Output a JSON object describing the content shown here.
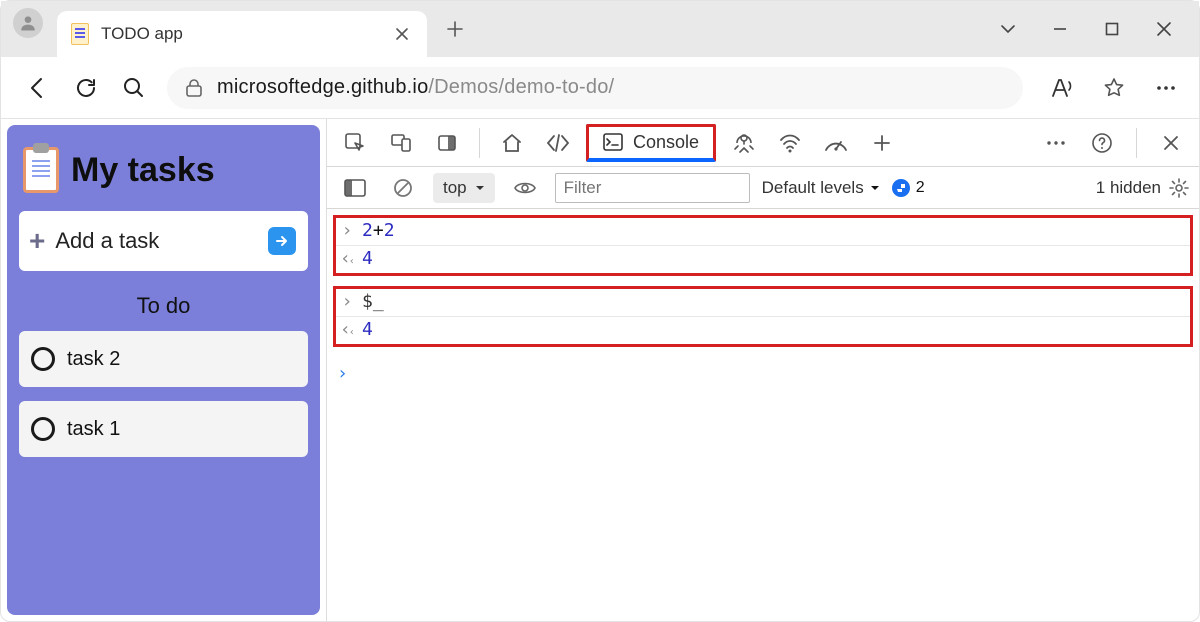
{
  "window": {
    "tab_title": "TODO app"
  },
  "urlbar": {
    "host": "microsoftedge.github.io",
    "path": "/Demos/demo-to-do/"
  },
  "page": {
    "heading": "My tasks",
    "add_placeholder": "Add a task",
    "section": "To do",
    "tasks": [
      {
        "label": "task 2"
      },
      {
        "label": "task 1"
      }
    ]
  },
  "devtools": {
    "tabs": {
      "console": "Console"
    },
    "toolbar": {
      "context": "top",
      "filter_placeholder": "Filter",
      "levels": "Default levels",
      "issues_count": "2",
      "hidden": "1 hidden"
    },
    "log": [
      {
        "type": "group",
        "rows": [
          {
            "kind": "input",
            "text_html": "<span class='num'>2</span><span class='op'>+</span><span class='num'>2</span>"
          },
          {
            "kind": "output",
            "text_html": "<span class='num'>4</span>"
          }
        ]
      },
      {
        "type": "group",
        "rows": [
          {
            "kind": "input",
            "text_html": "<span class='var'>$_</span>"
          },
          {
            "kind": "output",
            "text_html": "<span class='num'>4</span>"
          }
        ]
      }
    ]
  }
}
